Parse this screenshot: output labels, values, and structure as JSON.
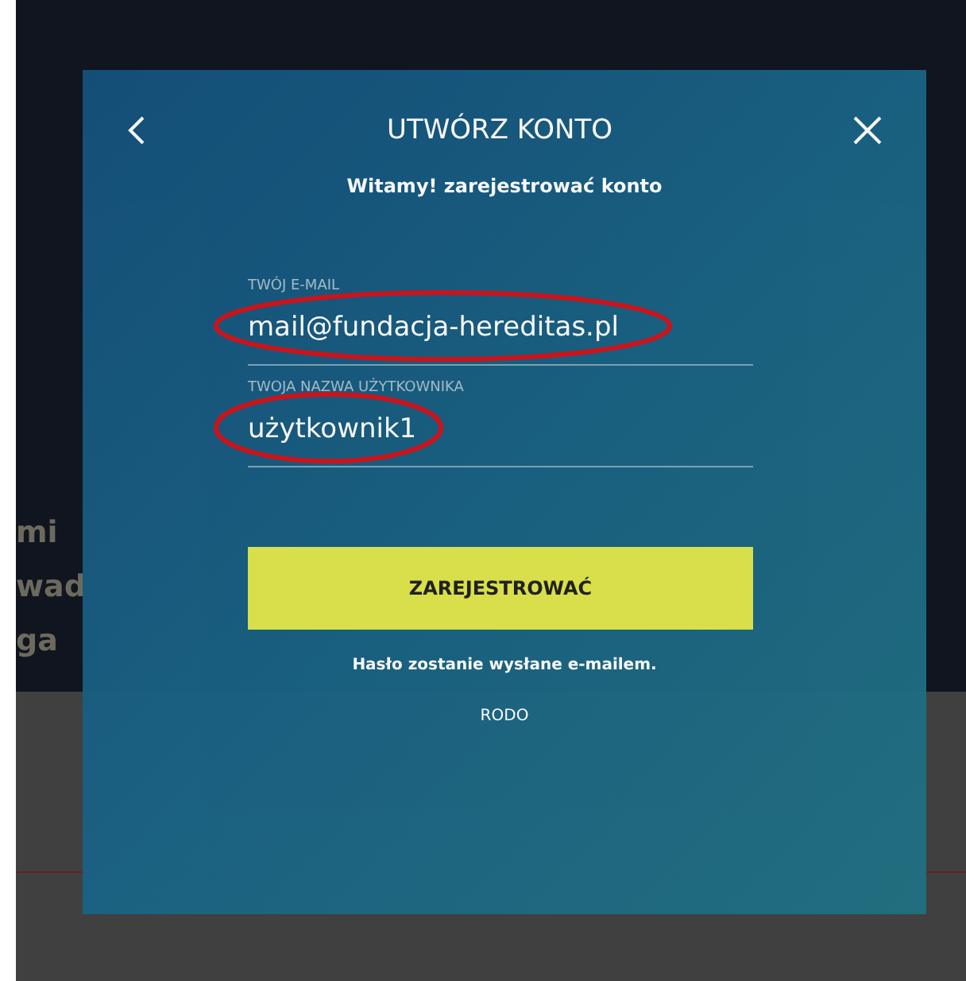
{
  "background": {
    "headline_lines": [
      "mi",
      "wad",
      "ga"
    ]
  },
  "dialog": {
    "title": "UTWÓRZ KONTO",
    "subtitle": "Witamy! zarejestrować konto",
    "fields": [
      {
        "label": "TWÓJ E-MAIL",
        "value": "mail@fundacja-hereditas.pl",
        "highlighted": true
      },
      {
        "label": "TWOJA NAZWA UŻYTKOWNIKA",
        "value": "użytkownik1",
        "highlighted": true
      }
    ],
    "submit_button": "ZAREJESTROWAĆ",
    "hint": "Hasło zostanie wysłane e-mailem.",
    "link": "RODO"
  }
}
